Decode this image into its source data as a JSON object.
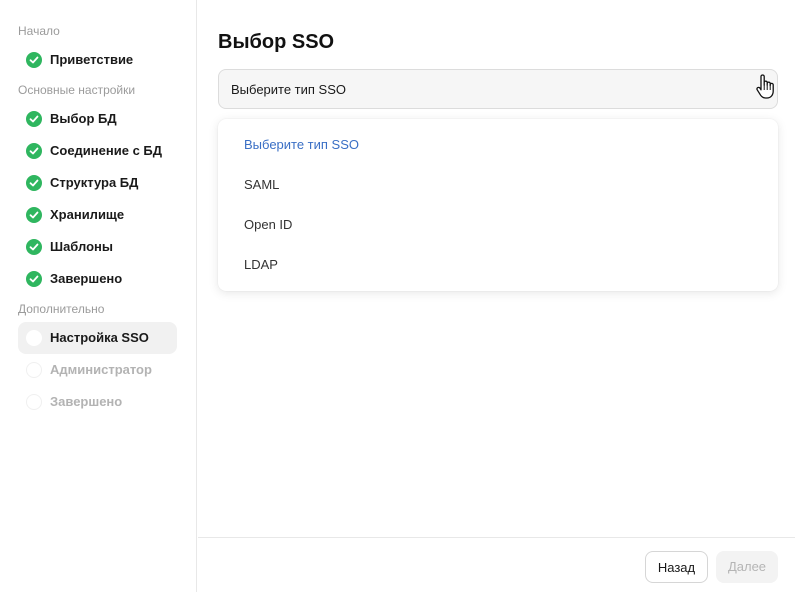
{
  "sidebar": {
    "sections": [
      {
        "label": "Начало"
      },
      {
        "label": "Основные настройки"
      },
      {
        "label": "Дополнительно"
      }
    ],
    "steps": [
      {
        "label": "Приветствие",
        "status": "done"
      },
      {
        "label": "Выбор БД",
        "status": "done"
      },
      {
        "label": "Соединение с БД",
        "status": "done"
      },
      {
        "label": "Структура БД",
        "status": "done"
      },
      {
        "label": "Хранилище",
        "status": "done"
      },
      {
        "label": "Шаблоны",
        "status": "done"
      },
      {
        "label": "Завершено",
        "status": "done"
      },
      {
        "label": "Настройка SSO",
        "status": "current"
      },
      {
        "label": "Администратор",
        "status": "pending"
      },
      {
        "label": "Завершено",
        "status": "pending"
      }
    ]
  },
  "main": {
    "title": "Выбор SSO",
    "select": {
      "value": "Выберите тип SSO",
      "options": [
        "Выберите тип SSO",
        "SAML",
        "Open ID",
        "LDAP"
      ],
      "selected_index": 0
    }
  },
  "footer": {
    "back_label": "Назад",
    "next_label": "Далее"
  },
  "colors": {
    "done": "#2fb65f",
    "selected_option": "#3a6fc5",
    "active_step_bg": "#f1f1f1"
  }
}
